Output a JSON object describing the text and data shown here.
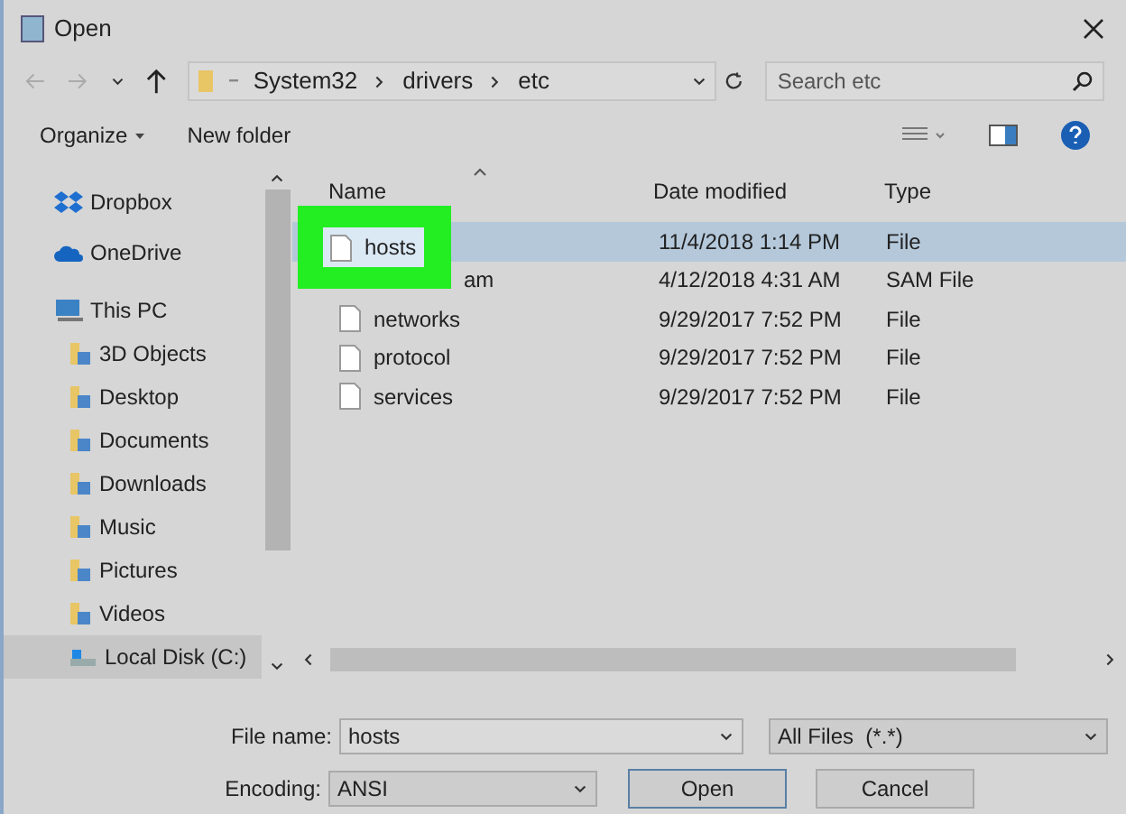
{
  "window": {
    "title": "Open"
  },
  "address": {
    "path": [
      "System32",
      "drivers",
      "etc"
    ]
  },
  "search": {
    "placeholder": "Search etc"
  },
  "toolbar": {
    "organize": "Organize",
    "new_folder": "New folder"
  },
  "sidebar": {
    "items": [
      {
        "label": "Dropbox",
        "kind": "dropbox",
        "selected": false
      },
      {
        "label": "OneDrive",
        "kind": "cloud",
        "selected": false
      },
      {
        "label": "This PC",
        "kind": "pc",
        "selected": false,
        "children": [
          {
            "label": "3D Objects",
            "kind": "folder",
            "selected": false
          },
          {
            "label": "Desktop",
            "kind": "folder",
            "selected": false
          },
          {
            "label": "Documents",
            "kind": "folder",
            "selected": false
          },
          {
            "label": "Downloads",
            "kind": "folder",
            "selected": false
          },
          {
            "label": "Music",
            "kind": "folder",
            "selected": false
          },
          {
            "label": "Pictures",
            "kind": "folder",
            "selected": false
          },
          {
            "label": "Videos",
            "kind": "folder",
            "selected": false
          },
          {
            "label": "Local Disk (C:)",
            "kind": "drive",
            "selected": true
          }
        ]
      }
    ]
  },
  "table": {
    "columns": [
      "Name",
      "Date modified",
      "Type"
    ],
    "rows": [
      {
        "name": "hosts",
        "date": "11/4/2018 1:14 PM",
        "type": "File",
        "selected": true,
        "highlighted": true
      },
      {
        "name": "am",
        "date": "4/12/2018 4:31 AM",
        "type": "SAM File",
        "selected": false,
        "highlighted": false
      },
      {
        "name": "networks",
        "date": "9/29/2017 7:52 PM",
        "type": "File",
        "selected": false,
        "highlighted": false
      },
      {
        "name": "protocol",
        "date": "9/29/2017 7:52 PM",
        "type": "File",
        "selected": false,
        "highlighted": false
      },
      {
        "name": "services",
        "date": "9/29/2017 7:52 PM",
        "type": "File",
        "selected": false,
        "highlighted": false
      }
    ]
  },
  "file_name": {
    "label": "File name:",
    "value": "hosts"
  },
  "file_type": {
    "value": "All Files  (*.*)"
  },
  "encoding": {
    "label": "Encoding:",
    "value": "ANSI"
  },
  "buttons": [
    "Open",
    "Cancel"
  ]
}
